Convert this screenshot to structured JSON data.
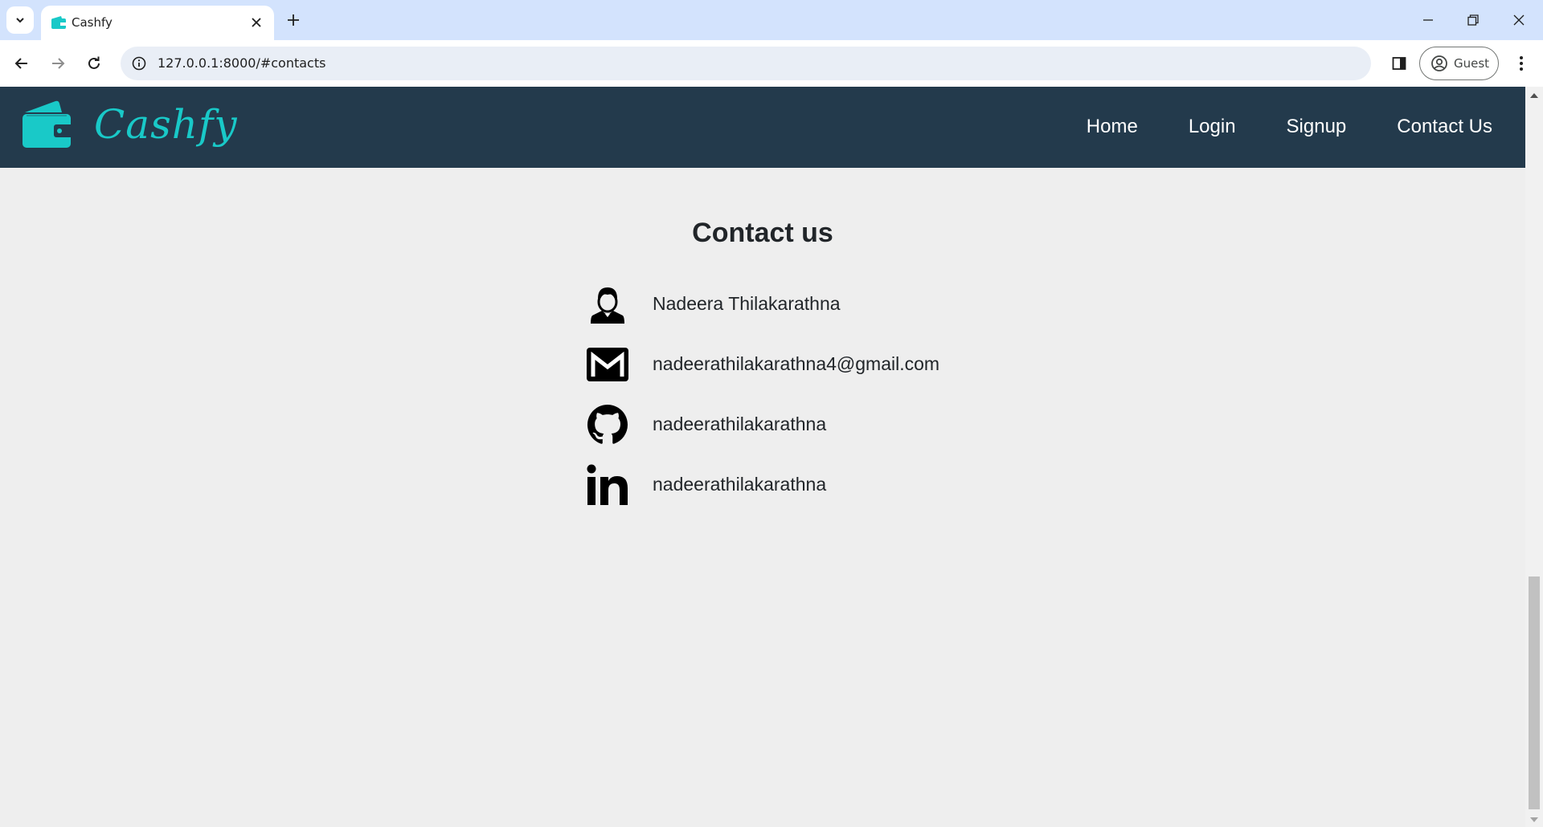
{
  "browser": {
    "tab_title": "Cashfy",
    "url": "127.0.0.1:8000/#contacts",
    "profile_label": "Guest"
  },
  "site": {
    "brand": "Cashfy",
    "brand_color": "#19c9c8",
    "nav_bg": "#233a4c",
    "nav_links": [
      {
        "label": "Home"
      },
      {
        "label": "Login"
      },
      {
        "label": "Signup"
      },
      {
        "label": "Contact Us"
      }
    ]
  },
  "contact": {
    "title": "Contact us",
    "items": [
      {
        "icon": "person-icon",
        "text": "Nadeera Thilakarathna"
      },
      {
        "icon": "gmail-icon",
        "text": "nadeerathilakarathna4@gmail.com"
      },
      {
        "icon": "github-icon",
        "text": "nadeerathilakarathna"
      },
      {
        "icon": "linkedin-icon",
        "text": "nadeerathilakarathna"
      }
    ]
  }
}
